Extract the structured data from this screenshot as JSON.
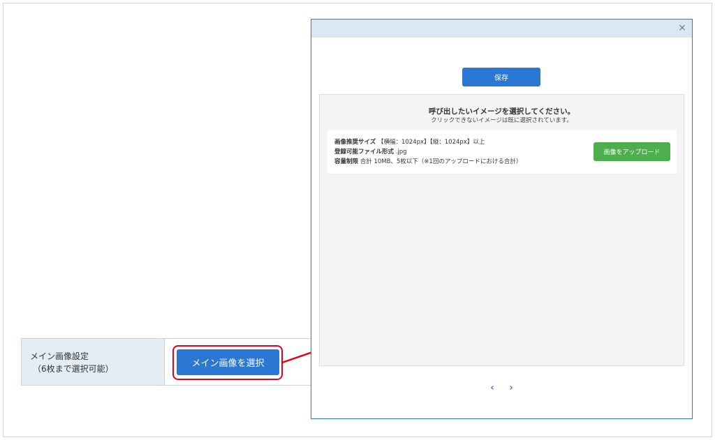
{
  "form": {
    "label_line1": "メイン画像設定",
    "label_line2": "（6枚まで選択可能）",
    "select_button": "メイン画像を選択"
  },
  "modal": {
    "close": "×",
    "save_button": "保存",
    "title": "呼び出したいイメージを選択してください。",
    "subtitle": "クリックできないイメージは既に選択されています。",
    "info": {
      "size_label": "画像推奨サイズ",
      "size_value": "【横幅：1024px】【縦：1024px】以上",
      "format_label": "登録可能ファイル形式",
      "format_value": ".jpg",
      "limit_label": "容量制限",
      "limit_value": "合計 10MB、5枚以下（※1回のアップロードにおける合計）"
    },
    "upload_button": "画像をアップロード",
    "pager_prev": "‹",
    "pager_next": "›"
  },
  "colors": {
    "primary": "#2b77d4",
    "success": "#4cae4c",
    "highlight": "#e2001a",
    "header": "#dbe7f5",
    "label_bg": "#e4ecf4"
  }
}
